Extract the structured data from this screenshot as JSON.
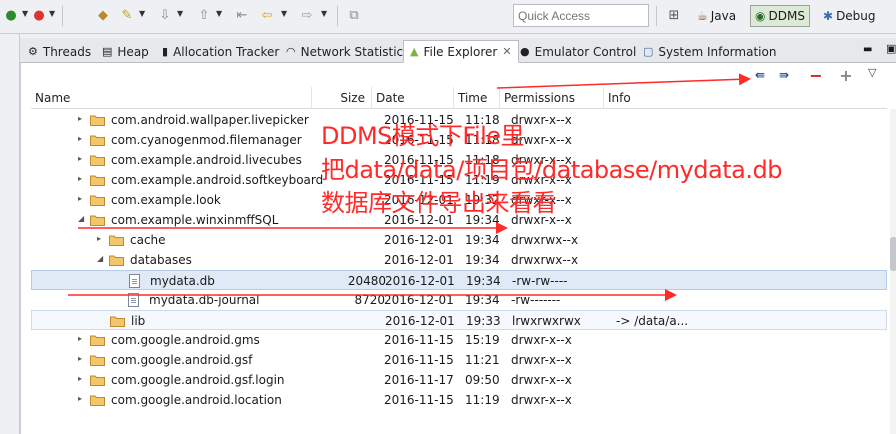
{
  "toolbar": {
    "quick_access_placeholder": "Quick Access",
    "perspectives": [
      {
        "label": "Java"
      },
      {
        "label": "DDMS"
      },
      {
        "label": "Debug"
      }
    ]
  },
  "tabs": [
    {
      "label": "Threads"
    },
    {
      "label": "Heap"
    },
    {
      "label": "Allocation Tracker"
    },
    {
      "label": "Network Statistics"
    },
    {
      "label": "File Explorer",
      "active": true
    },
    {
      "label": "Emulator Control"
    },
    {
      "label": "System Information"
    }
  ],
  "columns": {
    "name": "Name",
    "size": "Size",
    "date": "Date",
    "time": "Time",
    "permissions": "Permissions",
    "info": "Info"
  },
  "rows": [
    {
      "name": "com.android.wallpaper.livepicker",
      "size": "",
      "date": "2016-11-15",
      "time": "11:18",
      "perm": "drwxr-x--x",
      "info": ""
    },
    {
      "name": "com.cyanogenmod.filemanager",
      "size": "",
      "date": "2016-11-15",
      "time": "11:18",
      "perm": "drwxr-x--x",
      "info": ""
    },
    {
      "name": "com.example.android.livecubes",
      "size": "",
      "date": "2016-11-15",
      "time": "11:18",
      "perm": "drwxr-x--x",
      "info": ""
    },
    {
      "name": "com.example.android.softkeyboard",
      "size": "",
      "date": "2016-11-15",
      "time": "11:19",
      "perm": "drwxr-x--x",
      "info": ""
    },
    {
      "name": "com.example.look",
      "size": "",
      "date": "2016-12-01",
      "time": "19:32",
      "perm": "drwxr-x--x",
      "info": ""
    },
    {
      "name": "com.example.winxinmffSQL",
      "size": "",
      "date": "2016-12-01",
      "time": "19:34",
      "perm": "drwxr-x--x",
      "info": ""
    },
    {
      "name": "cache",
      "size": "",
      "date": "2016-12-01",
      "time": "19:34",
      "perm": "drwxrwx--x",
      "info": ""
    },
    {
      "name": "databases",
      "size": "",
      "date": "2016-12-01",
      "time": "19:34",
      "perm": "drwxrwx--x",
      "info": ""
    },
    {
      "name": "mydata.db",
      "size": "20480",
      "date": "2016-12-01",
      "time": "19:34",
      "perm": "-rw-rw----",
      "info": ""
    },
    {
      "name": "mydata.db-journal",
      "size": "8720",
      "date": "2016-12-01",
      "time": "19:34",
      "perm": "-rw-------",
      "info": ""
    },
    {
      "name": "lib",
      "size": "",
      "date": "2016-12-01",
      "time": "19:33",
      "perm": "lrwxrwxrwx",
      "info": "-> /data/a..."
    },
    {
      "name": "com.google.android.gms",
      "size": "",
      "date": "2016-11-15",
      "time": "15:19",
      "perm": "drwxr-x--x",
      "info": ""
    },
    {
      "name": "com.google.android.gsf",
      "size": "",
      "date": "2016-11-15",
      "time": "11:21",
      "perm": "drwxr-x--x",
      "info": ""
    },
    {
      "name": "com.google.android.gsf.login",
      "size": "",
      "date": "2016-11-17",
      "time": "09:50",
      "perm": "drwxr-x--x",
      "info": ""
    },
    {
      "name": "com.google.android.location",
      "size": "",
      "date": "2016-11-15",
      "time": "11:19",
      "perm": "drwxr-x--x",
      "info": ""
    }
  ],
  "annotation": {
    "line1": "DDMS模式下File里",
    "line2": "把data/data/项目包/database/mydata.db",
    "line3": "数据库文件导出来看看",
    "color": "#ff2a2a"
  }
}
